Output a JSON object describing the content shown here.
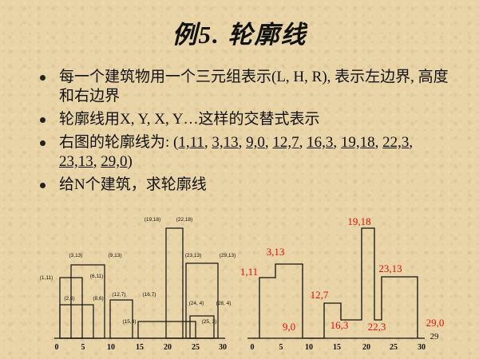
{
  "title": "例5. 轮廓线",
  "bullets": [
    {
      "text": "每一个建筑物用一个三元组表示(L, H, R), 表示左边界, 高度和右边界"
    },
    {
      "text": "轮廓线用X, Y, X, Y…这样的交替式表示"
    },
    {
      "prefix": "右图的轮廓线为: (",
      "items": [
        "1,11",
        "3,13",
        "9,0",
        "12,7",
        "16,3",
        "19,18",
        "22,3",
        "23,13",
        "29,0"
      ],
      "suffix": ")"
    },
    {
      "text": "给N个建筑，求轮廓线"
    }
  ],
  "left_chart": {
    "ticks": [
      "0",
      "5",
      "10",
      "15",
      "20",
      "25",
      "30"
    ],
    "labels": [
      "(1,11)",
      "(3,13)",
      "(9,13)",
      "(6,11)",
      "(2,6)",
      "(8,6)",
      "(12,7)",
      "(16,7)",
      "(19,18)",
      "(22,18)",
      "(23,13)",
      "(29,13)",
      "(15,3)",
      "(24, 4)",
      "(28, 4)",
      "(25, 3)"
    ]
  },
  "right_chart": {
    "ticks": [
      "0",
      "5",
      "10",
      "15",
      "20",
      "25",
      "30"
    ],
    "labels": [
      "1,11",
      "3,13",
      "9,0",
      "12,7",
      "16,3",
      "19,18",
      "22,3",
      "23,13",
      "29,0"
    ],
    "label_color": "#e01010"
  },
  "page_number": "29"
}
